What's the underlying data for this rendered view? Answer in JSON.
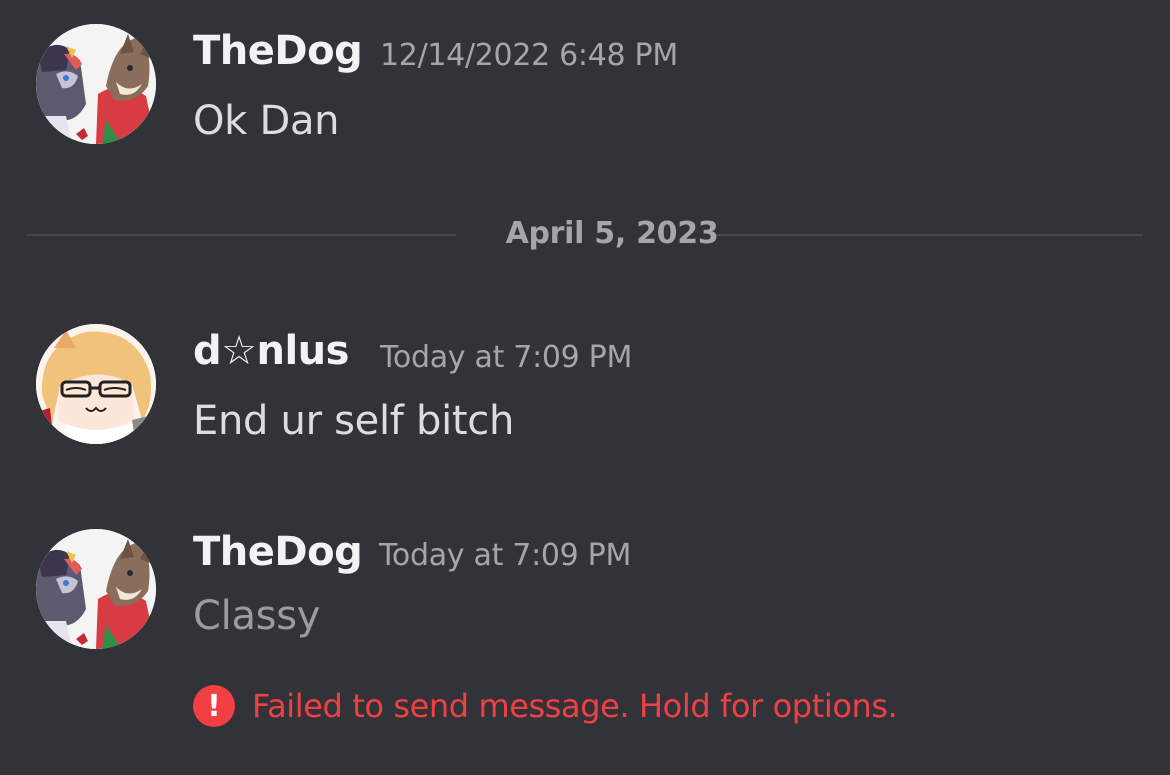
{
  "messages": [
    {
      "username": "TheDog",
      "timestamp": "12/14/2022 6:48 PM",
      "content": "Ok Dan",
      "avatar_icon": "wolf-couple-avatar"
    },
    {
      "username": "d☆nlus",
      "timestamp": "Today at 7:09 PM",
      "content": "End ur self bitch",
      "avatar_icon": "anime-girl-avatar"
    },
    {
      "username": "TheDog",
      "timestamp": "Today at 7:09 PM",
      "content": "Classy",
      "avatar_icon": "wolf-couple-avatar",
      "status": "failed"
    }
  ],
  "date_divider": "April 5, 2023",
  "error": {
    "icon": "exclamation-icon",
    "text": "Failed to send message. Hold for options."
  },
  "colors": {
    "background": "#313338",
    "username": "#f2f3f5",
    "timestamp": "#a3a6aa",
    "message_text": "#dbdee1",
    "pending_text": "#9a9ca1",
    "error": "#f23f43"
  }
}
